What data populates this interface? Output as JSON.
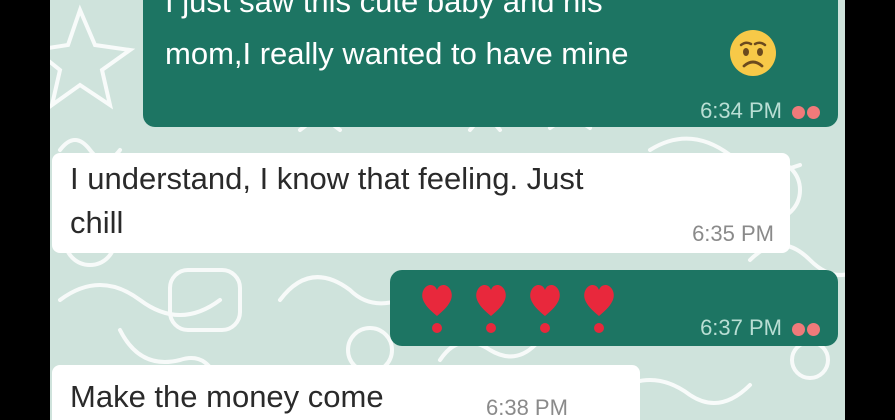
{
  "messages": [
    {
      "direction": "outgoing",
      "line1": "I just saw this cute baby and his",
      "line2": "mom,I really wanted to have mine",
      "emoji": "worried-face",
      "time": "6:34 PM",
      "status": "read"
    },
    {
      "direction": "incoming",
      "line1": "I understand, I know that feeling. Just",
      "line2": "chill",
      "time": "6:35 PM"
    },
    {
      "direction": "outgoing",
      "emoji": [
        "heavy-heart-exclamation",
        "heavy-heart-exclamation",
        "heavy-heart-exclamation",
        "heavy-heart-exclamation"
      ],
      "time": "6:37 PM",
      "status": "read"
    },
    {
      "direction": "incoming",
      "line1": "Make the money come",
      "time": "6:38 PM"
    }
  ],
  "colors": {
    "outgoing_bubble": "#1d7563",
    "incoming_bubble": "#ffffff",
    "wallpaper": "#cfe3dc",
    "read_ticks": "#f07a7a"
  }
}
